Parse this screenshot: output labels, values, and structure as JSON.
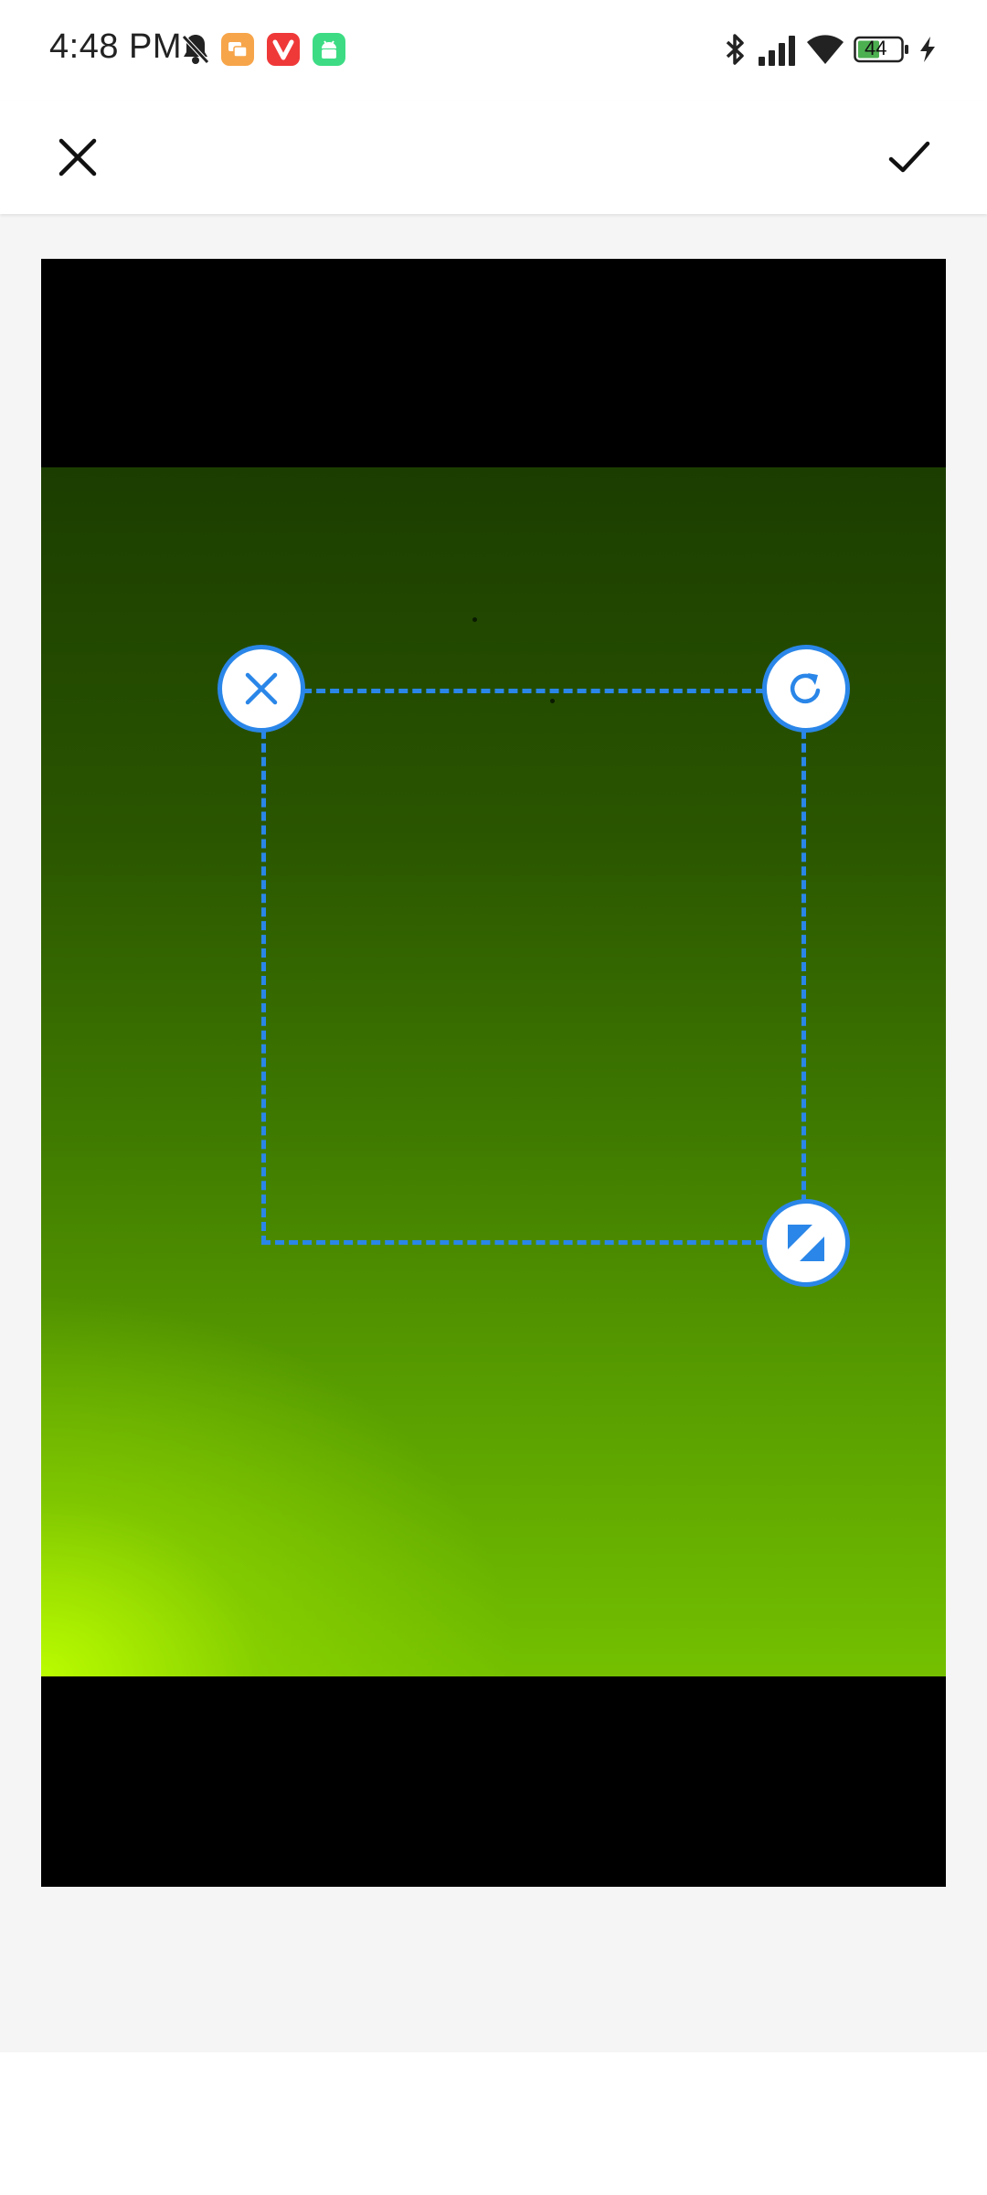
{
  "status_bar": {
    "time": "4:48 PM",
    "battery_level": "44",
    "icons": [
      "silent-bell-icon",
      "chat-app-icon",
      "vivaldi-app-icon",
      "android-app-icon",
      "bluetooth-icon",
      "signal-icon",
      "wifi-icon",
      "battery-icon",
      "charging-icon"
    ],
    "colors": {
      "chat_app": "#f7a54a",
      "vivaldi_app": "#ef3939",
      "android_app": "#3ddc84",
      "battery_fill": "#4caf50"
    }
  },
  "toolbar": {
    "close_icon": "close-icon",
    "confirm_icon": "check-icon"
  },
  "editor": {
    "selection_handles": [
      "delete-handle",
      "rotate-handle",
      "resize-handle"
    ],
    "accent_color": "#2a86e8"
  }
}
